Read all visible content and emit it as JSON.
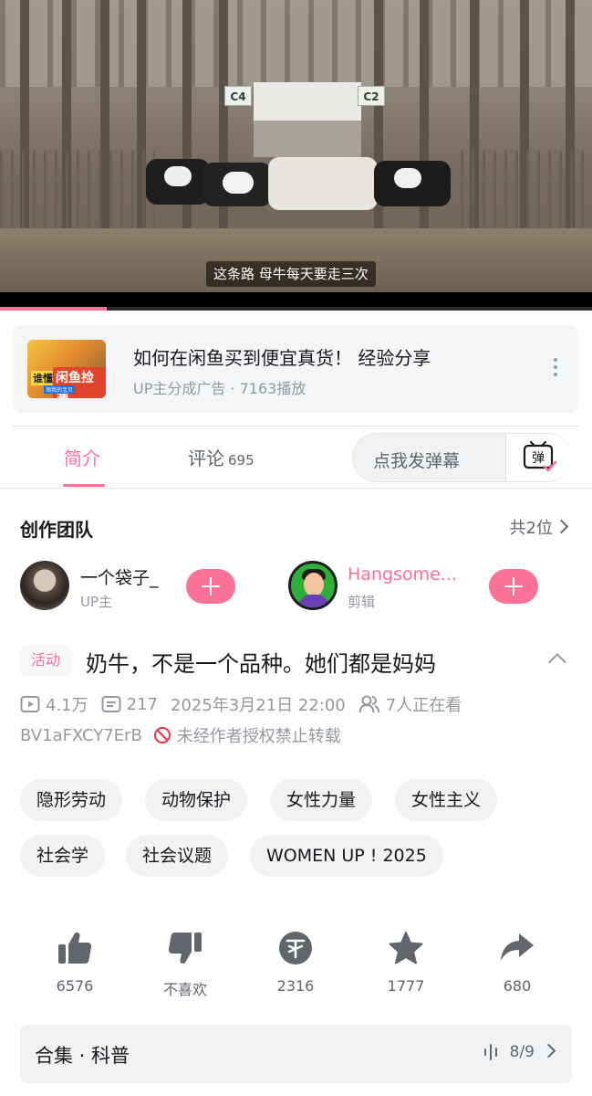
{
  "player": {
    "subtitle": "这条路 母牛每天要走三次",
    "signs": [
      "C4",
      "C2"
    ],
    "progress_fraction": 0.18
  },
  "ad": {
    "title": "如何在闲鱼买到便宜真货！ 经验分享",
    "meta": "UP主分成广告 · 7163播放",
    "thumb_text": [
      "谁懂",
      "闲鱼捡漏",
      "淘我的宝贝"
    ]
  },
  "tabs": {
    "intro": "简介",
    "comments": "评论",
    "comments_count": "695",
    "danmaku_placeholder": "点我发弹幕",
    "danmaku_button": "弹"
  },
  "team": {
    "title": "创作团队",
    "count": "共2位",
    "members": [
      {
        "name": "一个袋子_",
        "role": "UP主"
      },
      {
        "name": "Hangsome...",
        "role": "剪辑"
      }
    ]
  },
  "video": {
    "badge": "活动",
    "title": "奶牛，不是一个品种。她们都是妈妈",
    "views": "4.1万",
    "danmaku_count": "217",
    "date": "2025年3月21日 22:00",
    "watching": "7人正在看",
    "bvid": "BV1aFXCY7ErB",
    "reprint": "未经作者授权禁止转载"
  },
  "tags": [
    "隐形劳动",
    "动物保护",
    "女性力量",
    "女性主义",
    "社会学",
    "社会议题",
    "WOMEN UP ! 2025"
  ],
  "actions": {
    "like": "6576",
    "dislike": "不喜欢",
    "coin": "2316",
    "favorite": "1777",
    "share": "680"
  },
  "collection": {
    "title": "合集 · 科普",
    "progress": "8/9"
  },
  "colors": {
    "accent": "#fb7299",
    "text_primary": "#18191c",
    "text_secondary": "#61666d",
    "text_muted": "#9499a0",
    "chip_bg": "#f1f2f3"
  }
}
